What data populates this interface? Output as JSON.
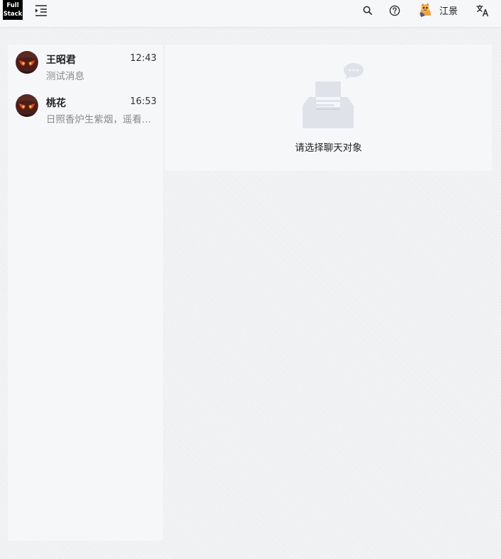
{
  "app": {
    "logo_line1": "Full",
    "logo_line2": "Stack"
  },
  "header": {
    "user_name": "江景",
    "icons": [
      "menu-fold-icon",
      "search-icon",
      "question-circle-icon",
      "translate-icon"
    ]
  },
  "conversations": [
    {
      "name": "王昭君",
      "time": "12:43",
      "preview": "测试消息"
    },
    {
      "name": "桃花",
      "time": "16:53",
      "preview": "日照香炉生紫烟，遥看瀑布挂前川"
    }
  ],
  "main": {
    "empty_text": "请选择聊天对象"
  },
  "colors": {
    "panel_bg": "#f6f7f9",
    "page_bg": "#eeeff1",
    "logo_bg": "#000000",
    "muted_text": "#8a8a8a",
    "illustration": "#dfe2e8"
  }
}
